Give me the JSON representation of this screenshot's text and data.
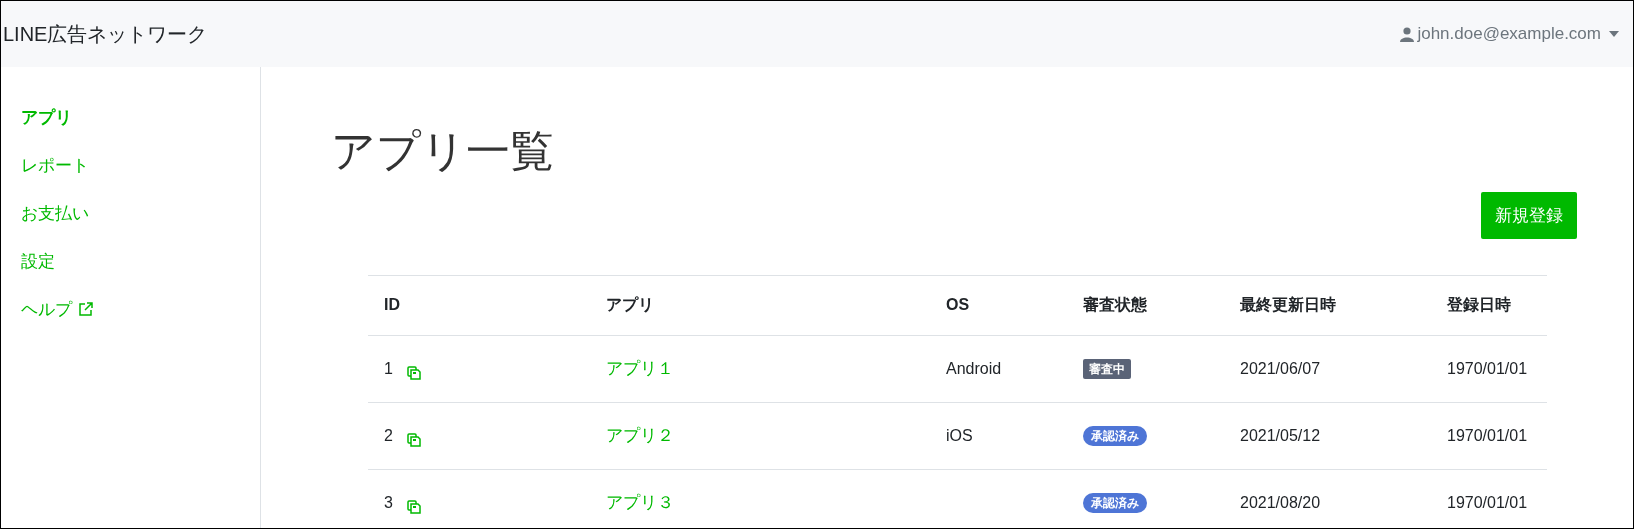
{
  "header": {
    "brand": "LINE広告ネットワーク",
    "user": "john.doe@example.com"
  },
  "sidebar": {
    "items": [
      {
        "label": "アプリ",
        "selected": true,
        "external": false
      },
      {
        "label": "レポート",
        "selected": false,
        "external": false
      },
      {
        "label": "お支払い",
        "selected": false,
        "external": false
      },
      {
        "label": "設定",
        "selected": false,
        "external": false
      },
      {
        "label": "ヘルプ",
        "selected": false,
        "external": true
      }
    ]
  },
  "page": {
    "title": "アプリ一覧",
    "new_button": "新規登録"
  },
  "table": {
    "columns": [
      "ID",
      "アプリ",
      "OS",
      "審査状態",
      "最終更新日時",
      "登録日時"
    ],
    "rows": [
      {
        "id": "1",
        "app": "アプリ１",
        "os": "Android",
        "status": {
          "label": "審査中",
          "kind": "reviewing"
        },
        "updated": "2021/06/07",
        "created": "1970/01/01"
      },
      {
        "id": "2",
        "app": "アプリ２",
        "os": "iOS",
        "status": {
          "label": "承認済み",
          "kind": "approved"
        },
        "updated": "2021/05/12",
        "created": "1970/01/01"
      },
      {
        "id": "3",
        "app": "アプリ３",
        "os": "",
        "status": {
          "label": "承認済み",
          "kind": "approved"
        },
        "updated": "2021/08/20",
        "created": "1970/01/01"
      }
    ]
  }
}
